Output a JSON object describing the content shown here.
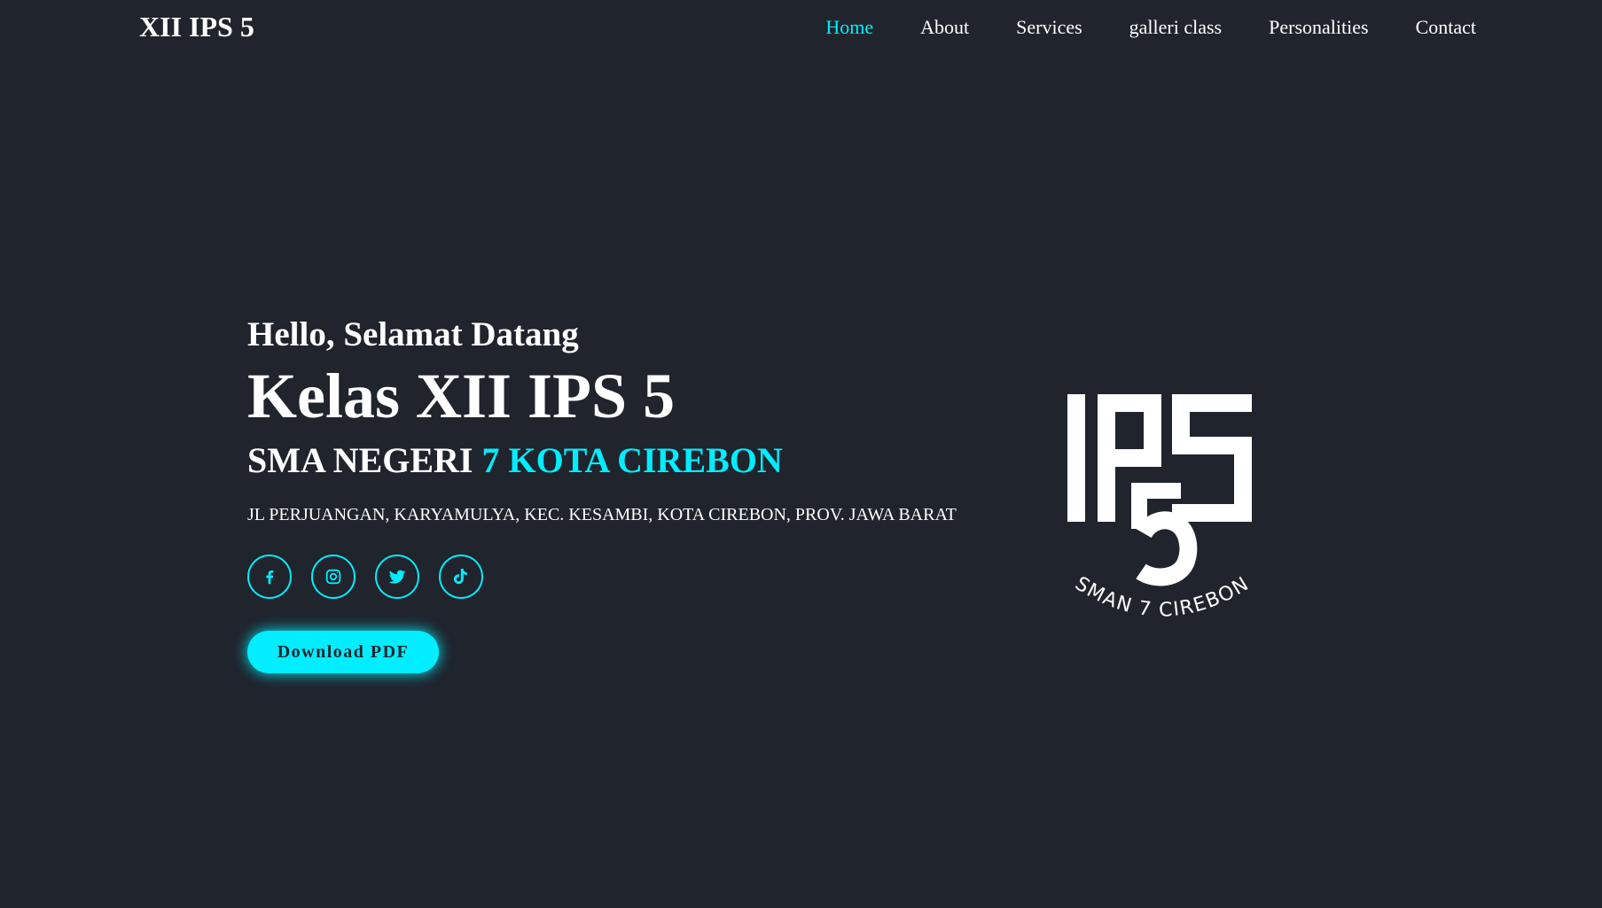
{
  "brand": "XII IPS 5",
  "nav": {
    "items": [
      {
        "label": "Home",
        "active": true
      },
      {
        "label": "About"
      },
      {
        "label": "Services"
      },
      {
        "label": "galleri class"
      },
      {
        "label": "Personalities"
      },
      {
        "label": "Contact"
      }
    ]
  },
  "hero": {
    "greeting": "Hello, Selamat Datang",
    "title": "Kelas XII IPS 5",
    "school_prefix": "SMA NEGERI ",
    "school_accent": "7 KOTA CIREBON",
    "address": "JL PERJUANGAN, KARYAMULYA, KEC. KESAMBI, KOTA CIREBON, PROV. JAWA BARAT",
    "socials": [
      "facebook-icon",
      "instagram-icon",
      "twitter-icon",
      "tiktok-icon"
    ],
    "download_label": "Download PDF"
  },
  "logo": {
    "mark": "IPS 5",
    "caption": "SMAN 7 CIREBON"
  },
  "colors": {
    "background": "#1f242d",
    "accent": "#00eeff",
    "text": "#ffffff"
  }
}
